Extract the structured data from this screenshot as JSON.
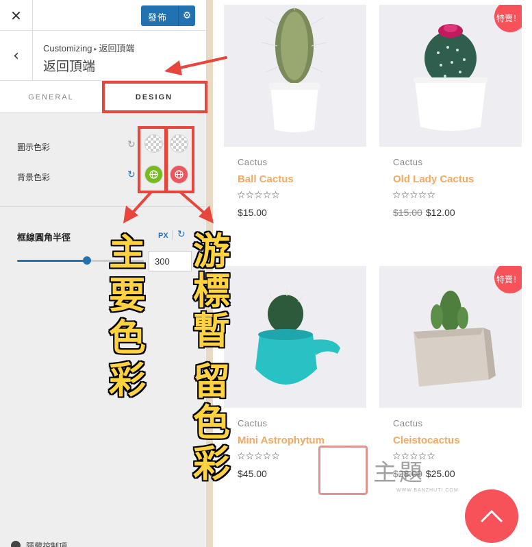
{
  "customizer": {
    "close_icon": "close-icon",
    "publish_label": "發佈",
    "publish_gear_icon": "gear-icon",
    "breadcrumb": {
      "root": "Customizing",
      "current": "返回頂端"
    },
    "section_title": "返回頂端",
    "tabs": [
      {
        "label": "GENERAL",
        "active": false
      },
      {
        "label": "DESIGN",
        "active": true
      }
    ],
    "colors": {
      "icon_color_label": "圖示色彩",
      "bg_color_label": "背景色彩",
      "bg_primary_hex": "#77bb1f",
      "bg_hover_hex": "#e9575f"
    },
    "radius": {
      "label": "框線圓角半徑",
      "unit": "PX",
      "value": "300",
      "slider_fraction": 0.55
    },
    "bottom_control_label": "隱藏控制項"
  },
  "preview": {
    "products": [
      {
        "category": "Cactus",
        "name": "Ball Cactus",
        "stars": "☆☆☆☆☆",
        "price": "$15.00",
        "old_price": "",
        "sale": ""
      },
      {
        "category": "Cactus",
        "name": "Old Lady Cactus",
        "stars": "☆☆☆☆☆",
        "price": "$12.00",
        "old_price": "$15.00",
        "sale": "特賣！"
      },
      {
        "category": "Cactus",
        "name": "Mini Astrophytum",
        "stars": "☆☆☆☆☆",
        "price": "$45.00",
        "old_price": "",
        "sale": ""
      },
      {
        "category": "Cactus",
        "name": "Cleistocactus",
        "stars": "☆☆☆☆☆",
        "price": "$25.00",
        "old_price": "$28.00",
        "sale": "特賣！"
      }
    ],
    "accent_color": "#f7525a",
    "name_color": "#f5a860",
    "watermark": {
      "text": "主題",
      "url": "WWW.BANZHUTI.COM"
    }
  },
  "annotations": {
    "left_label": [
      "主",
      "要",
      "色",
      "彩"
    ],
    "right_label": [
      "游",
      "標",
      "暫",
      "留",
      "色",
      "彩"
    ],
    "highlight_color": "#e8453c"
  }
}
